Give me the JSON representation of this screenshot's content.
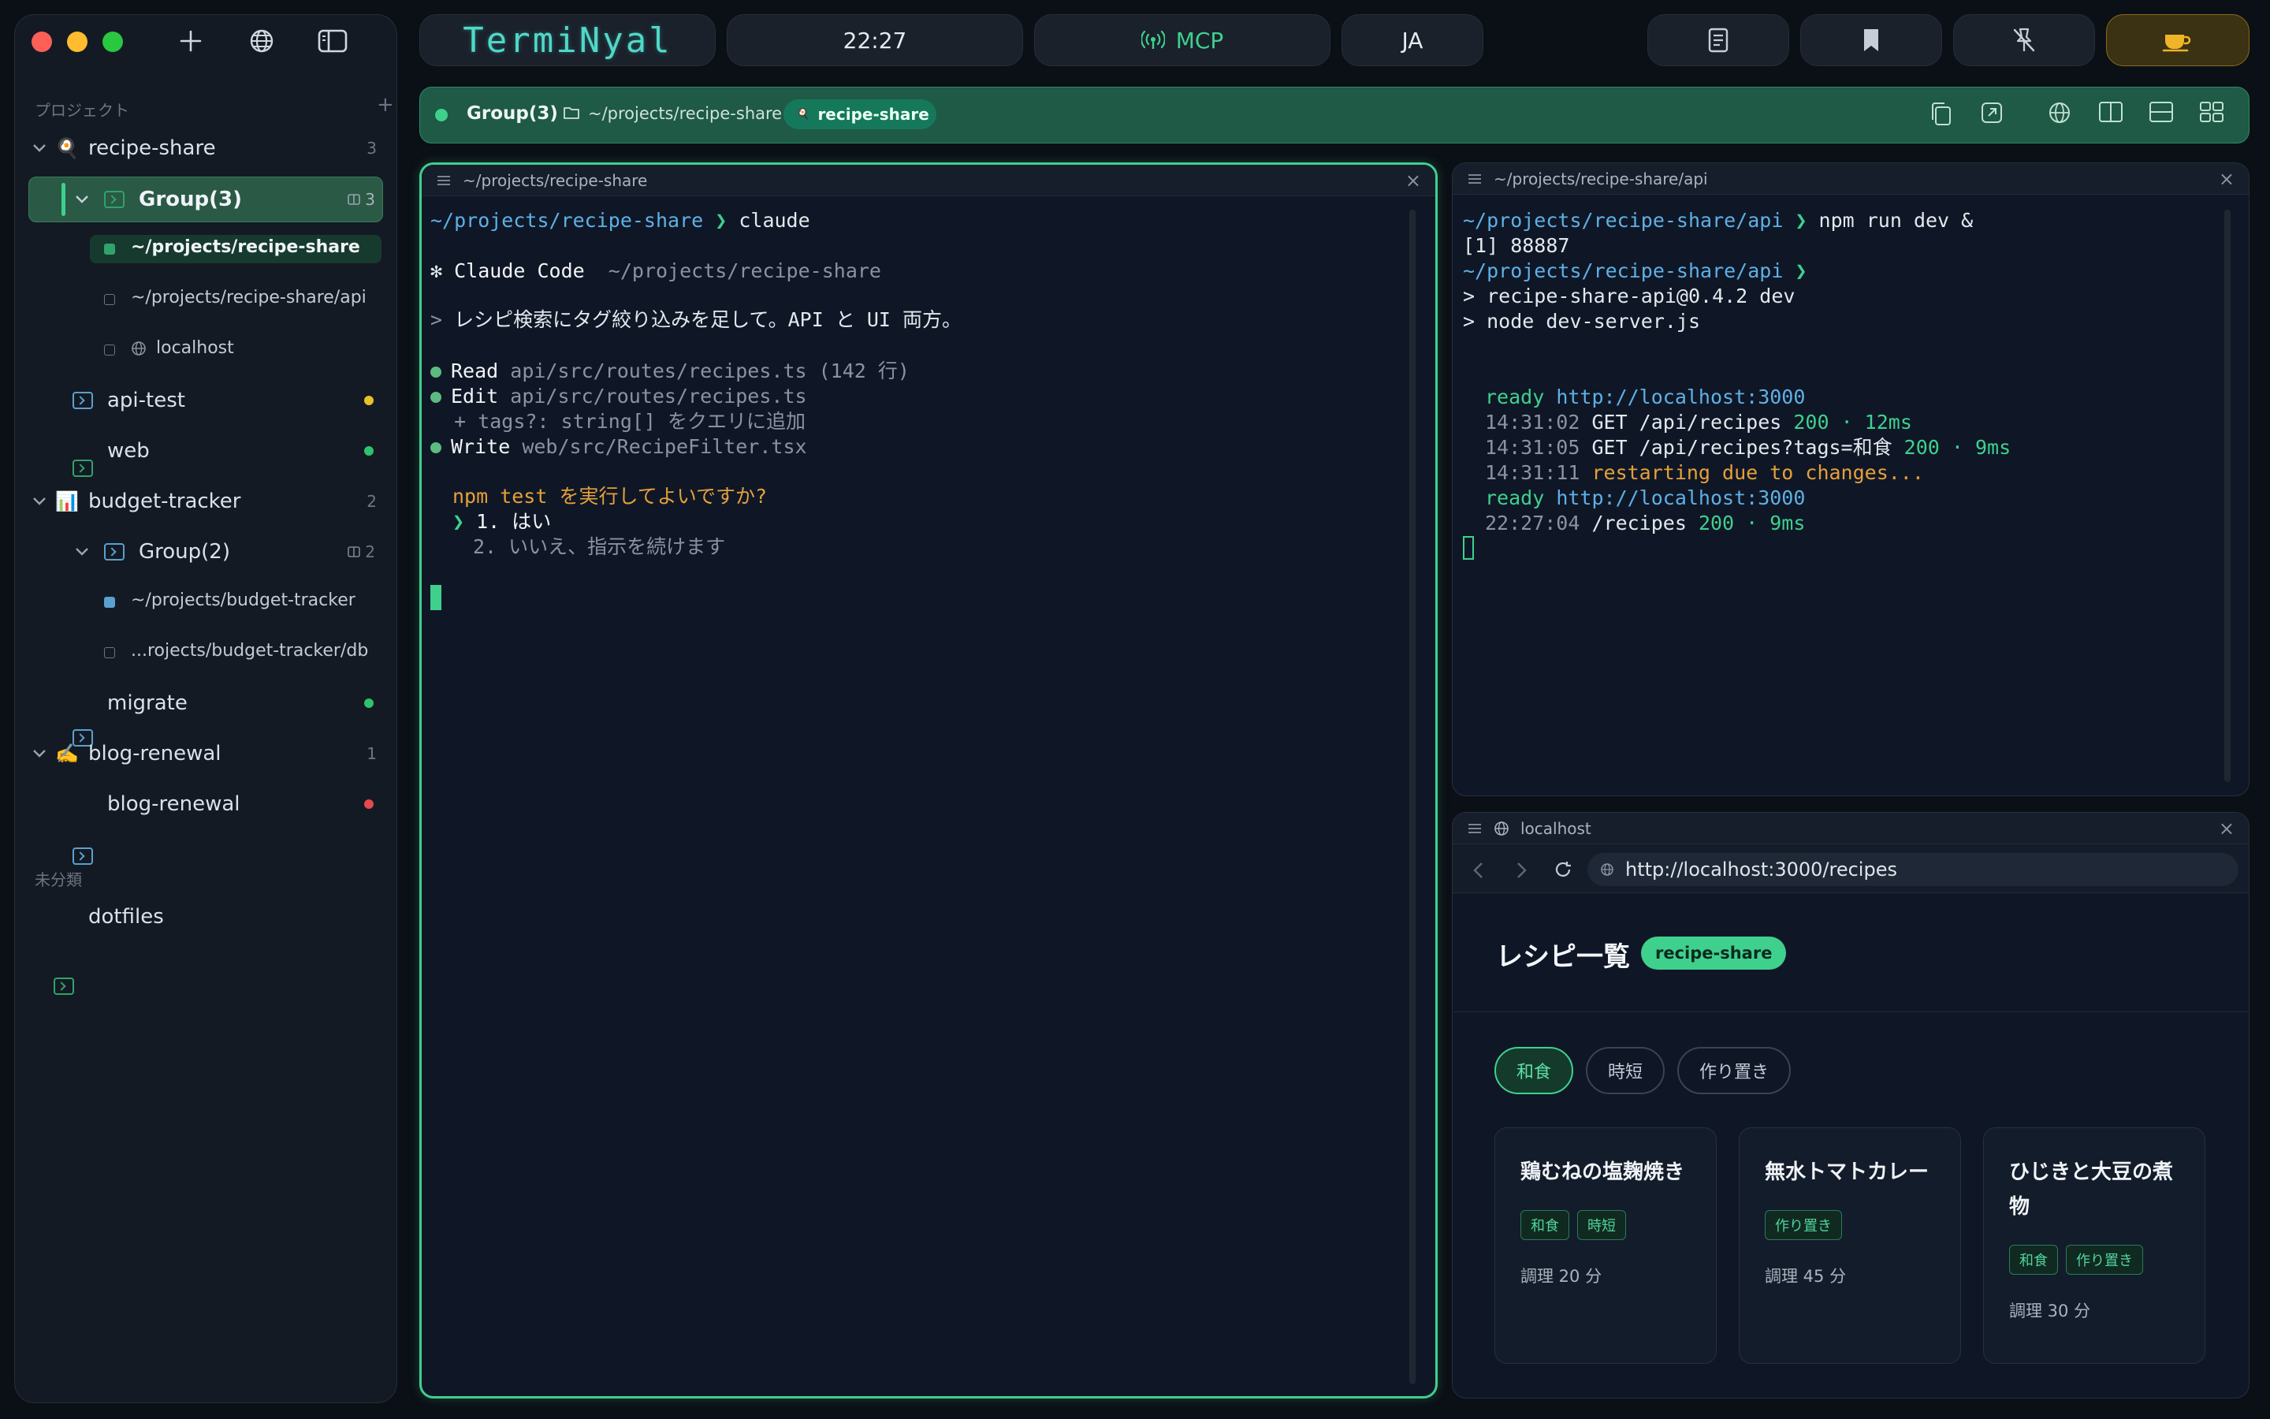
{
  "app": {
    "brand": "TermiNyal",
    "clock": "22:27",
    "mcp_label": "MCP",
    "lang_label": "JA",
    "accent": "#3fd08e"
  },
  "sidebar": {
    "projects_label": "プロジェクト",
    "add_symbol": "+",
    "uncategorized_label": "未分類",
    "items": [
      {
        "label": "recipe-share",
        "count": "3",
        "emoji": "🍳"
      },
      {
        "label": "Group(3)",
        "count": "3"
      },
      {
        "label": "~/projects/recipe-share"
      },
      {
        "label": "~/projects/recipe-share/api"
      },
      {
        "label": "localhost"
      },
      {
        "label": "api-test",
        "status_color": "#e8c02a"
      },
      {
        "label": "web",
        "status_color": "#2fc26d"
      },
      {
        "label": "budget-tracker",
        "count": "2",
        "emoji": "📊"
      },
      {
        "label": "Group(2)",
        "count": "2"
      },
      {
        "label": "~/projects/budget-tracker"
      },
      {
        "label": "...rojects/budget-tracker/db"
      },
      {
        "label": "migrate",
        "status_color": "#2fc26d"
      },
      {
        "label": "blog-renewal",
        "count": "1",
        "emoji": "✍️"
      },
      {
        "label": "blog-renewal",
        "status_color": "#e5484d"
      },
      {
        "label": "dotfiles"
      }
    ]
  },
  "groupbar": {
    "group_name": "Group(3)",
    "path": "~/projects/recipe-share",
    "project_chip": "recipe-share"
  },
  "pane_left": {
    "title": "~/projects/recipe-share",
    "close": "×",
    "lines": {
      "l1_path": "~/projects/recipe-share",
      "l1_prompt": " ❯ ",
      "l1_cmd": "claude",
      "l2_star": "✻ ",
      "l2_label": "Claude Code",
      "l2_path": "  ~/projects/recipe-share",
      "l3_gt": "> ",
      "l3_text": "レシピ検索にタグ絞り込みを足して。API と UI 両方。",
      "l4_verb": "Read",
      "l4_rest": " api/src/routes/recipes.ts (142 行)",
      "l5_verb": "Edit",
      "l5_rest": " api/src/routes/recipes.ts",
      "l6_text": "  + tags?: string[] をクエリに追加",
      "l7_verb": "Write",
      "l7_rest": " web/src/RecipeFilter.tsx",
      "q_text": "npm test を実行してよいですか?",
      "opt1_mark": "❯ ",
      "opt1_text": "1. はい",
      "opt2_text": "2. いいえ、指示を続けます"
    }
  },
  "pane_right": {
    "title": "~/projects/recipe-share/api",
    "close": "×",
    "lines": {
      "a1_path": "~/projects/recipe-share/api",
      "a1_prompt": " ❯ ",
      "a1_cmd": "npm run dev &",
      "a2": "[1] 88887",
      "a3_path": "~/projects/recipe-share/api",
      "a3_prompt": " ❯",
      "a4": "> recipe-share-api@0.4.2 dev",
      "a5": "> node dev-server.js",
      "r1_ready": "ready",
      "r1_url": " http://localhost:3000",
      "r2_time": "14:31:02",
      "r2_req": " GET /api/recipes ",
      "r2_status": "200 · 12ms",
      "r3_time": "14:31:05",
      "r3_req": " GET /api/recipes?tags=和食 ",
      "r3_status": "200 · 9ms",
      "r4_time": "14:31:11",
      "r4_msg": " restarting due to changes...",
      "r5_ready": "ready",
      "r5_url": " http://localhost:3000",
      "r6_time": "22:27:04",
      "r6_req": " /recipes ",
      "r6_status": "200 · 9ms"
    }
  },
  "pane_browser": {
    "title": "localhost",
    "close": "×",
    "url": "http://localhost:3000/recipes",
    "page_title": "レシピ一覧",
    "badge": "recipe-share",
    "filters": [
      "和食",
      "時短",
      "作り置き"
    ],
    "active_filter": "和食",
    "cards": [
      {
        "title": "鶏むねの塩麹焼き",
        "tags": [
          "和食",
          "時短"
        ],
        "time": "調理 20 分"
      },
      {
        "title": "無水トマトカレー",
        "tags": [
          "作り置き"
        ],
        "time": "調理 45 分"
      },
      {
        "title": "ひじきと大豆の煮物",
        "tags": [
          "和食",
          "作り置き"
        ],
        "time": "調理 30 分"
      }
    ]
  }
}
